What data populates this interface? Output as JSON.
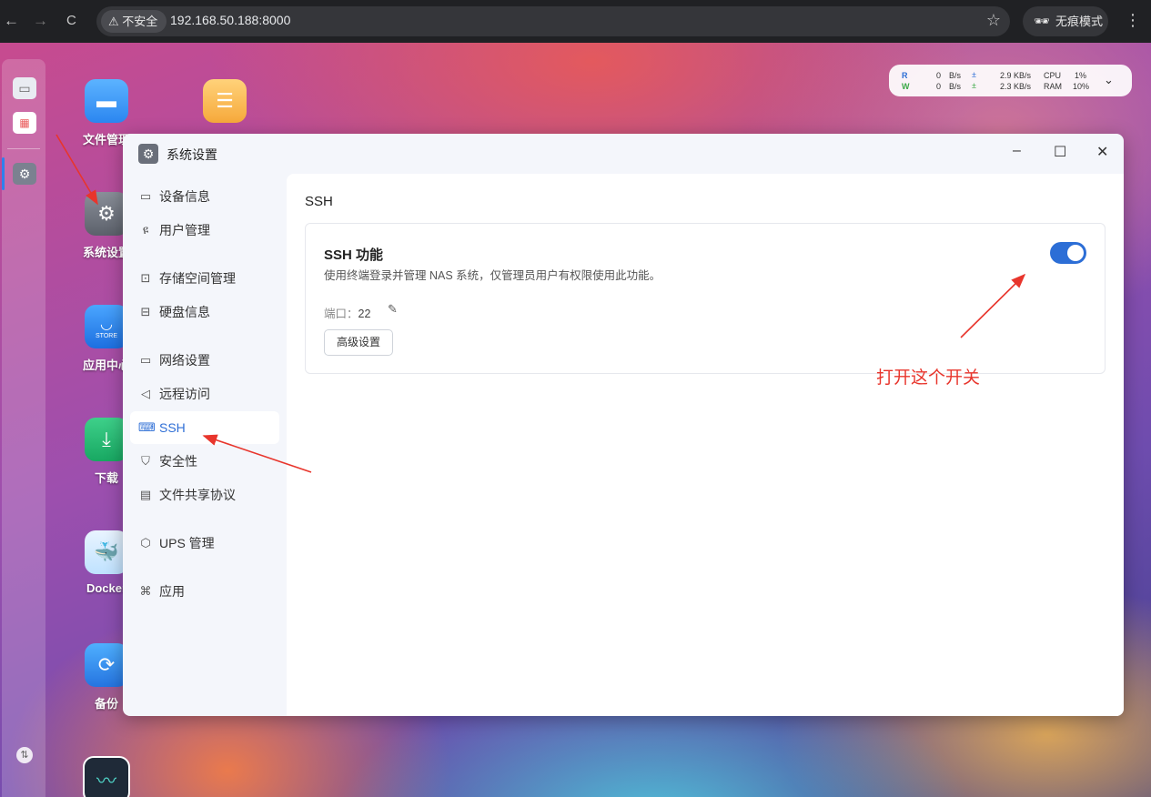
{
  "browser": {
    "back": "←",
    "forward": "→",
    "reload": "C",
    "security_label": "不安全",
    "url": "192.168.50.188:8000",
    "incognito_label": "无痕模式",
    "more": "⋮"
  },
  "netmon": {
    "r_label": "R",
    "r_value": "0",
    "r_unit": "B/s",
    "w_label": "W",
    "w_value": "0",
    "w_unit": "B/s",
    "up_rate": "2.9 KB/s",
    "down_rate": "2.3 KB/s",
    "cpu_label": "CPU",
    "cpu_value": "1%",
    "ram_label": "RAM",
    "ram_value": "10%"
  },
  "desktop": {
    "apps": [
      {
        "label": "文件管理",
        "icon": "folder-icon"
      },
      {
        "label": "系统设置",
        "icon": "gear-icon"
      },
      {
        "label": "应用中心",
        "icon": "store-icon",
        "sub": "STORE"
      },
      {
        "label": "下载",
        "icon": "download-icon"
      },
      {
        "label": "Docker",
        "icon": "docker-icon"
      },
      {
        "label": "备份",
        "icon": "backup-icon"
      },
      {
        "label": "",
        "icon": "monitor-icon"
      }
    ]
  },
  "window": {
    "title": "系统设置",
    "minimize": "–",
    "maximize": "☐",
    "close": "✕"
  },
  "sidebar": {
    "items": [
      {
        "label": "设备信息",
        "icon": "▭"
      },
      {
        "label": "用户管理",
        "icon": "ዩ"
      },
      {
        "label": "存储空间管理",
        "icon": "⊡"
      },
      {
        "label": "硬盘信息",
        "icon": "⊟"
      },
      {
        "label": "网络设置",
        "icon": "▭"
      },
      {
        "label": "远程访问",
        "icon": "◁"
      },
      {
        "label": "SSH",
        "icon": "⌨"
      },
      {
        "label": "安全性",
        "icon": "⛉"
      },
      {
        "label": "文件共享协议",
        "icon": "▤"
      },
      {
        "label": "UPS 管理",
        "icon": "⬡"
      },
      {
        "label": "应用",
        "icon": "⌘"
      }
    ]
  },
  "content": {
    "title": "SSH",
    "card": {
      "title": "SSH 功能",
      "description": "使用终端登录并管理 NAS 系统，仅管理员用户有权限使用此功能。",
      "port_label": "端口：",
      "port_value": "22",
      "advanced_button": "高级设置",
      "toggle_on": true
    }
  },
  "annotation": {
    "text": "打开这个开关",
    "color": "#e8352c"
  }
}
